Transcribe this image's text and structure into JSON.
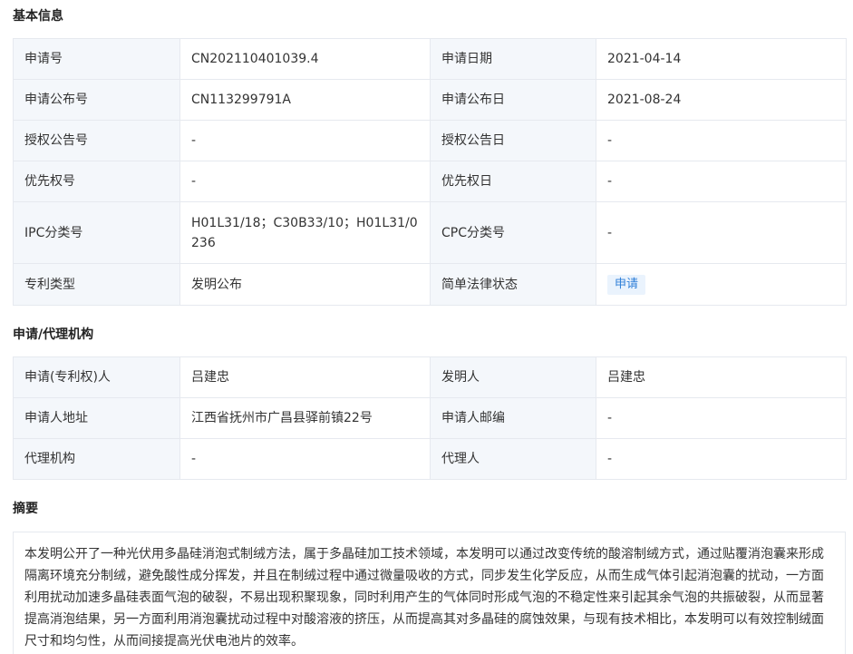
{
  "basic": {
    "title": "基本信息",
    "rows": [
      [
        "申请号",
        "CN202110401039.4",
        "申请日期",
        "2021-04-14"
      ],
      [
        "申请公布号",
        "CN113299791A",
        "申请公布日",
        "2021-08-24"
      ],
      [
        "授权公告号",
        "-",
        "授权公告日",
        "-"
      ],
      [
        "优先权号",
        "-",
        "优先权日",
        "-"
      ],
      [
        "IPC分类号",
        "H01L31/18；C30B33/10；H01L31/0236",
        "CPC分类号",
        "-"
      ],
      [
        "专利类型",
        "发明公布",
        "简单法律状态",
        "申请"
      ]
    ],
    "status_color": "#2f7fd8"
  },
  "agency": {
    "title": "申请/代理机构",
    "rows": [
      [
        "申请(专利权)人",
        "吕建忠",
        "发明人",
        "吕建忠"
      ],
      [
        "申请人地址",
        "江西省抚州市广昌县驿前镇22号",
        "申请人邮编",
        "-"
      ],
      [
        "代理机构",
        "-",
        "代理人",
        "-"
      ]
    ]
  },
  "abstract": {
    "title": "摘要",
    "text": "本发明公开了一种光伏用多晶硅消泡式制绒方法，属于多晶硅加工技术领域，本发明可以通过改变传统的酸溶制绒方式，通过贴覆消泡囊来形成隔离环境充分制绒，避免酸性成分挥发，并且在制绒过程中通过微量吸收的方式，同步发生化学反应，从而生成气体引起消泡囊的扰动，一方面利用扰动加速多晶硅表面气泡的破裂，不易出现积聚现象，同时利用产生的气体同时形成气泡的不稳定性来引起其余气泡的共振破裂，从而显著提高消泡结果，另一方面利用消泡囊扰动过程中对酸溶液的挤压，从而提高其对多晶硅的腐蚀效果，与现有技术相比，本发明可以有效控制绒面尺寸和均匀性，从而间接提高光伏电池片的效率。"
  }
}
